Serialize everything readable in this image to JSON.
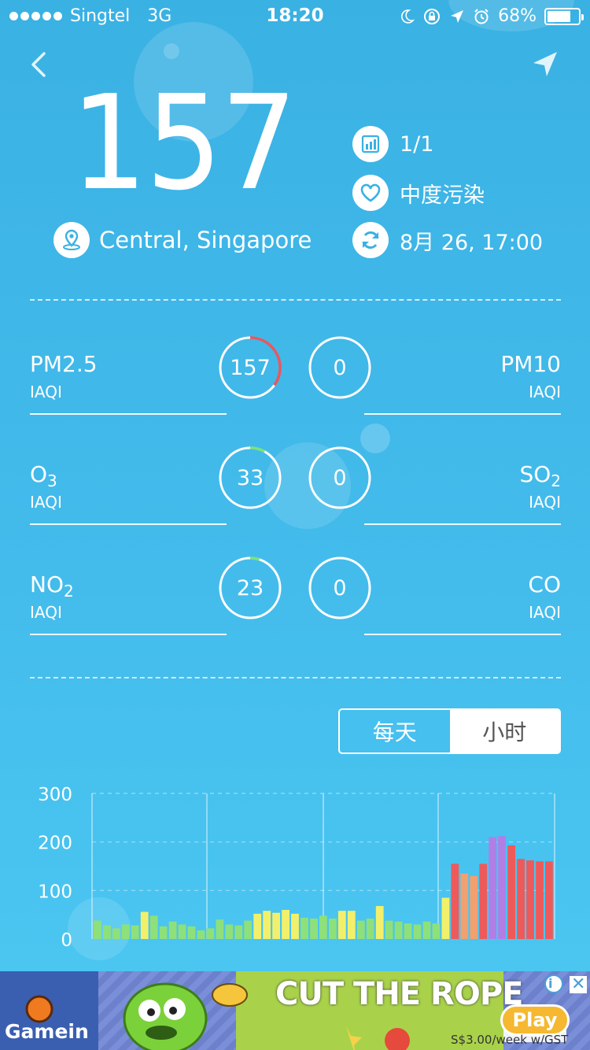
{
  "status_bar": {
    "carrier": "Singtel",
    "network": "3G",
    "time": "18:20",
    "battery": "68%"
  },
  "aqi": {
    "value": "157",
    "location": "Central, Singapore",
    "station_index": "1/1",
    "level": "中度污染",
    "updated": "8月 26, 17:00"
  },
  "pollutants": [
    {
      "left_name": "PM2.5",
      "left_sub": "",
      "left_caption": "IAQI",
      "left_value": "157",
      "left_fraction": 0.35,
      "left_color": "#e8585c",
      "right_name": "PM10",
      "right_sub": "",
      "right_caption": "IAQI",
      "right_value": "0"
    },
    {
      "left_name": "O",
      "left_sub": "3",
      "left_caption": "IAQI",
      "left_value": "33",
      "left_fraction": 0.08,
      "left_color": "#7de37a",
      "right_name": "SO",
      "right_sub": "2",
      "right_caption": "IAQI",
      "right_value": "0"
    },
    {
      "left_name": "NO",
      "left_sub": "2",
      "left_caption": "IAQI",
      "left_value": "23",
      "left_fraction": 0.05,
      "left_color": "#7de37a",
      "right_name": "CO",
      "right_sub": "",
      "right_caption": "IAQI",
      "right_value": "0"
    }
  ],
  "toggle": {
    "daily": "每天",
    "hourly": "小时",
    "selected": "hourly"
  },
  "chart_data": {
    "type": "bar",
    "ylim": [
      0,
      300
    ],
    "yticks": [
      "300",
      "200",
      "100",
      "0"
    ],
    "values": [
      38,
      28,
      22,
      30,
      28,
      56,
      48,
      26,
      36,
      30,
      26,
      18,
      22,
      40,
      30,
      28,
      38,
      52,
      58,
      54,
      60,
      52,
      44,
      42,
      48,
      42,
      58,
      58,
      38,
      42,
      68,
      38,
      36,
      32,
      30,
      36,
      32,
      85,
      155,
      135,
      130,
      155,
      210,
      212,
      193,
      165,
      162,
      160,
      160
    ],
    "colors": {
      "good": "#8ee07a",
      "moderate": "#f2f06a",
      "unhealthy_sensitive": "#f2a070",
      "unhealthy": "#ee5a5a",
      "very_unhealthy": "#b27ee6"
    }
  },
  "ad": {
    "brand": "Gamein",
    "game": "CUT THE ROPE",
    "the": "the",
    "play": "Play",
    "price": "S$3.00/week w/GST"
  }
}
